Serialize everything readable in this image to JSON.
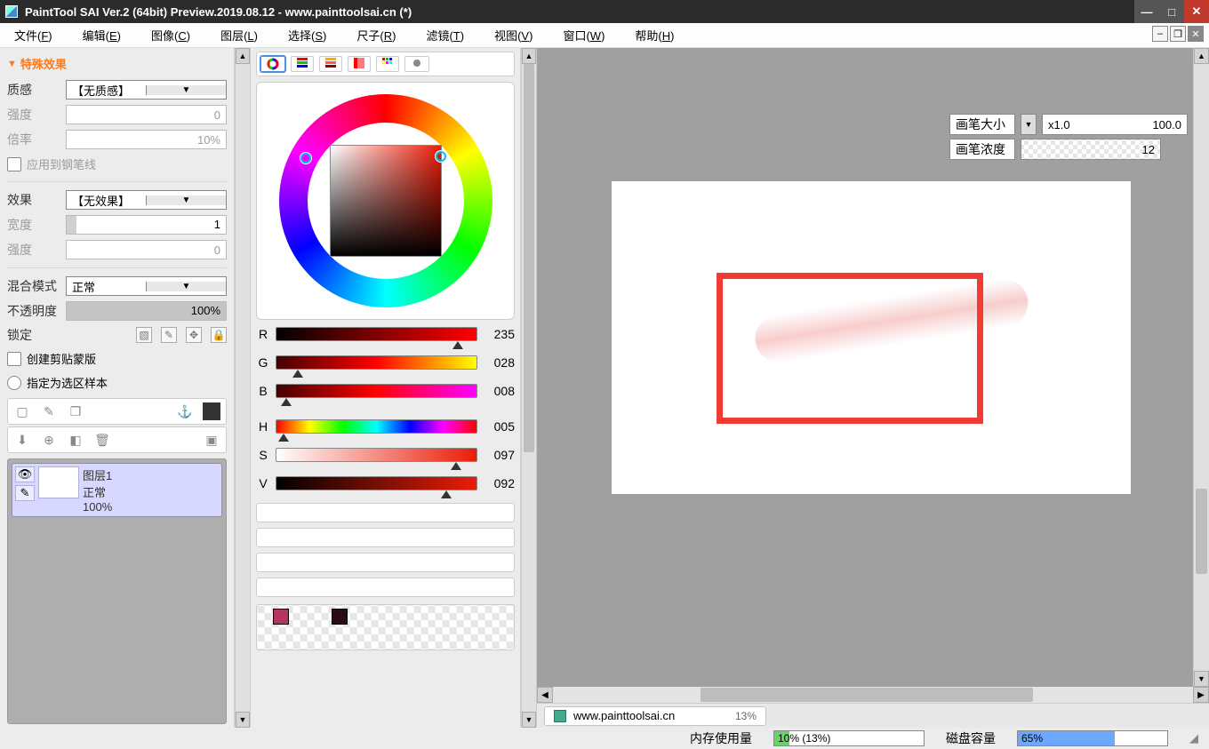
{
  "title": "PaintTool SAI Ver.2 (64bit) Preview.2019.08.12 - www.painttoolsai.cn (*)",
  "menu": {
    "file": "文件(",
    "file_u": "F",
    "edit": "编辑(",
    "edit_u": "E",
    "image": "图像(",
    "image_u": "C",
    "layer": "图层(",
    "layer_u": "L",
    "select": "选择(",
    "select_u": "S",
    "ruler": "尺子(",
    "ruler_u": "R",
    "filter": "滤镜(",
    "filter_u": "T",
    "view": "视图(",
    "view_u": "V",
    "window": "窗口(",
    "window_u": "W",
    "help": "帮助(",
    "help_u": "H",
    "close_paren": ")"
  },
  "fx": {
    "section": "特殊效果",
    "texture_label": "质感",
    "texture_value": "【无质感】",
    "strength_label": "强度",
    "strength_value": "0",
    "scale_label": "倍率",
    "scale_value": "10%",
    "applypen": "应用到钢笔线",
    "effect_label": "效果",
    "effect_value": "【无效果】",
    "width_label": "宽度",
    "width_value": "1",
    "strength2_label": "强度",
    "strength2_value": "0",
    "blend_label": "混合模式",
    "blend_value": "正常",
    "opacity_label": "不透明度",
    "opacity_value": "100%",
    "lock_label": "锁定",
    "clip": "创建剪贴蒙版",
    "selsrc": "指定为选区样本"
  },
  "layer": {
    "name": "图层1",
    "mode": "正常",
    "opacity": "100%"
  },
  "rgb": {
    "r_lab": "R",
    "r": "235",
    "g_lab": "G",
    "g": "028",
    "b_lab": "B",
    "b": "008",
    "h_lab": "H",
    "h": "005",
    "s_lab": "S",
    "s": "097",
    "v_lab": "V",
    "v": "092"
  },
  "brush": {
    "size_label": "画笔大小",
    "size_mul": "x1.0",
    "size_val": "100.0",
    "density_label": "画笔浓度",
    "density_val": "12"
  },
  "doctab": {
    "name": "www.painttoolsai.cn",
    "zoom": "13%"
  },
  "footer": {
    "mem_label": "内存使用量",
    "mem_text": "10% (13%)",
    "mem_fill": 10,
    "disk_label": "磁盘容量",
    "disk_text": "65%",
    "disk_fill": 65
  }
}
